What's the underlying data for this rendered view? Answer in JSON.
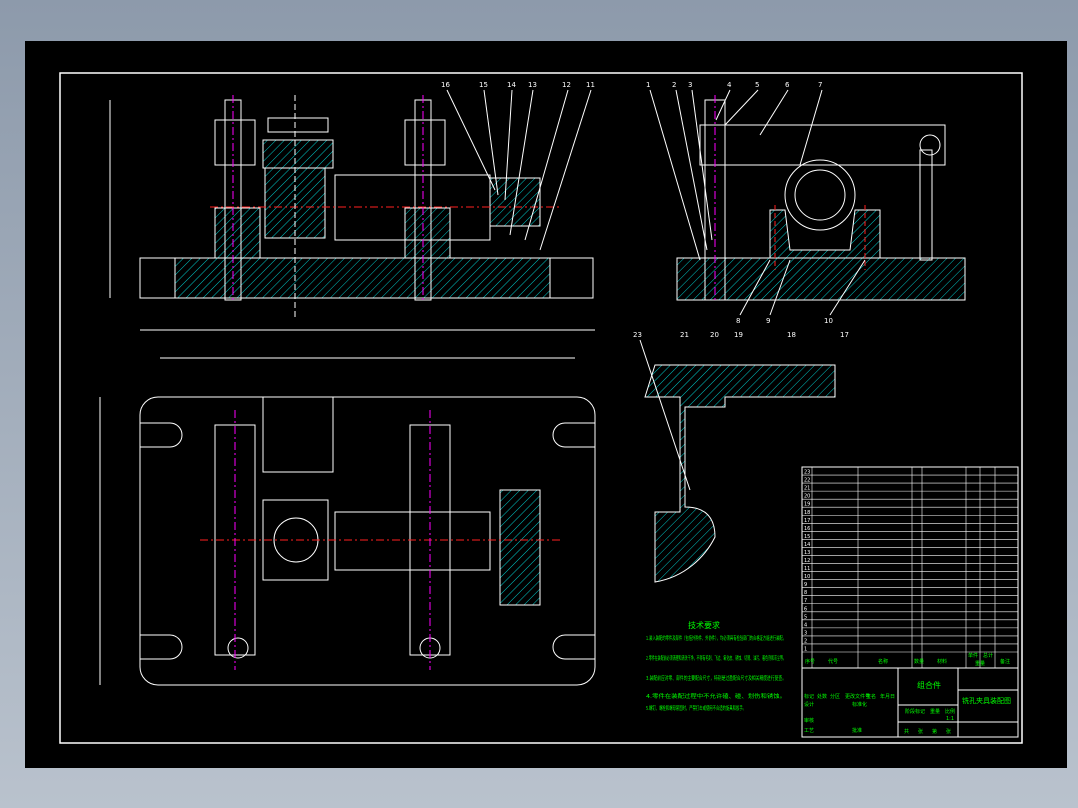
{
  "drawing": {
    "tech_requirements": {
      "title": "技术要求",
      "items": [
        "1.装入装配的零件及部件（包括外购件、外协件），均必须具有检验部门的合格证方能进行装配。",
        "2.零件在装配前必须清理和清洗干净，不得有毛刺、飞边、氧化皮、锈蚀、切屑、油污、着色剂和灰尘等。",
        "3.装配前应对零、部件的主要配合尺寸，特别是过盈配合尺寸及相关精度进行复查。",
        "4.零件在装配过程中不允许磕、碰、划伤和锈蚀。",
        "5.螺钉、螺栓和螺母紧固时，严禁打击或使用不合适的旋具和扳手。"
      ]
    },
    "title_block": {
      "assembly_label": "组合件",
      "drawing_title": "铣孔夹具装配图",
      "headers": [
        "序号",
        "代号",
        "名称",
        "数量",
        "材料",
        "单件",
        "总计",
        "重量",
        "备注"
      ],
      "sign_labels": [
        "标记",
        "处数",
        "分区",
        "更改文件号",
        "签名",
        "年月日"
      ],
      "role_labels": [
        "设计",
        "标准化",
        "审核",
        "工艺",
        "批准"
      ],
      "stage_labels": [
        "阶段标记",
        "重量",
        "比例"
      ],
      "bottom_labels": [
        "共",
        "张",
        "第",
        "张"
      ],
      "scale": "1:1"
    },
    "balloons_top_right": [
      "1",
      "2",
      "3",
      "4",
      "5",
      "6",
      "7",
      "8",
      "9",
      "10"
    ],
    "balloons_top_left": [
      "16",
      "15",
      "14",
      "13",
      "12",
      "11"
    ],
    "balloons_section": [
      "23",
      "21",
      "20",
      "19",
      "18",
      "17"
    ],
    "bom_row_numbers": [
      "23",
      "22",
      "21",
      "20",
      "19",
      "18",
      "17",
      "16",
      "15",
      "14",
      "13",
      "12",
      "11",
      "10",
      "9",
      "8",
      "7",
      "6",
      "5",
      "4",
      "3",
      "2",
      "1"
    ],
    "colors": {
      "outline": "#ffffff",
      "hatch": "#00c8c8",
      "text": "#00ff00",
      "centerline": "#ff00ff",
      "hidden": "#ff2020",
      "background": "#000000"
    }
  }
}
